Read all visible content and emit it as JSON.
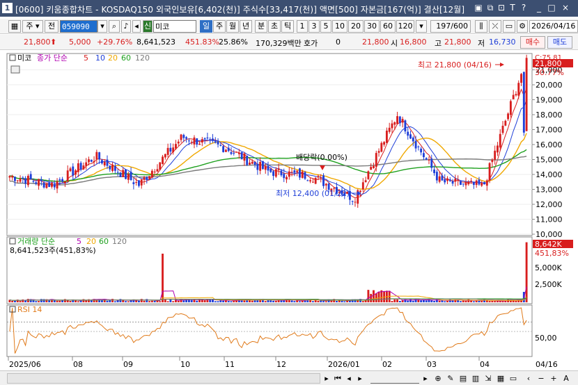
{
  "window": {
    "number": "1",
    "title": "[0600] 키움종합차트 - KOSDAQ150 외국인보유[6,402(천)] 주식수[33,417(천)] 액면[500] 자본금[167(억)] 결산[12월]"
  },
  "toolbar": {
    "code": "059090",
    "ju": "주",
    "jeon": "전",
    "badge_sin": "신",
    "stock_name": "미코",
    "periods": [
      "일",
      "주",
      "월",
      "년",
      "분",
      "초",
      "틱"
    ],
    "selected_period": "일",
    "intervals": [
      "1",
      "3",
      "5",
      "10",
      "20",
      "30",
      "60",
      "120"
    ],
    "count": "197/600",
    "date": "2026/04/16"
  },
  "quote": {
    "price": "21,800",
    "change": "5,000",
    "change_pct": "+29.76%",
    "volume": "8,641,523",
    "volume_pct": "451.83%",
    "turnover": "25.86%",
    "amount": "170,329백만",
    "hoga_label": "호가",
    "hoga_value": "0",
    "ask": "21,800",
    "open_label": "시",
    "open": "16,800",
    "high_label": "고",
    "high": "21,800",
    "low_label": "저",
    "low": "16,730",
    "sell": "매수",
    "buy": "매도"
  },
  "price_panel": {
    "name_label": "미코",
    "legend_prefix": "종가 단순",
    "ma": [
      {
        "period": "5",
        "color": "#d81e1e"
      },
      {
        "period": "10",
        "color": "#1f3fd8"
      },
      {
        "period": "20",
        "color": "#f0a800"
      },
      {
        "period": "60",
        "color": "#1ea01e"
      },
      {
        "period": "120",
        "color": "#7a7a7a"
      }
    ],
    "current_tag": "21,800",
    "current_pct": "30.77%",
    "top_tag": "C:75.81",
    "high_note": "최고 21,800 (04/16)",
    "low_note": "최저 12,400 (01/22)",
    "dividend_note": "배당락(0.00%)",
    "y_ticks": [
      "21,000",
      "20,000",
      "19,000",
      "18,000",
      "17,000",
      "16,000",
      "15,000",
      "14,000",
      "13,000",
      "12,000",
      "11,000",
      "10,000"
    ]
  },
  "volume_panel": {
    "legend_prefix": "거래량 단순",
    "ma": [
      {
        "period": "5",
        "color": "#b000b0"
      },
      {
        "period": "20",
        "color": "#f0a800"
      },
      {
        "period": "60",
        "color": "#1ea01e"
      },
      {
        "period": "120",
        "color": "#7a7a7a"
      }
    ],
    "value_label": "8,641,523주(451,83%)",
    "current_tag": "8,642K",
    "current_pct": "451,83%",
    "y_ticks": [
      "5,000K",
      "2,500K"
    ]
  },
  "rsi_panel": {
    "label": "RSI 14",
    "y_ticks": [
      "50,00"
    ]
  },
  "x_axis": [
    "2025/06",
    "08",
    "09",
    "10",
    "11",
    "12",
    "2026/01",
    "02",
    "03",
    "04",
    "04/16"
  ],
  "colors": {
    "up": "#d81e1e",
    "down": "#1f3fd8",
    "title_bg": "#3c4f71",
    "selected_tab": "#2e6fc5"
  },
  "chart_data": {
    "type": "candlestick",
    "period": "daily",
    "x_range": [
      "2025/06",
      "2026/04/16"
    ],
    "ylim": [
      10000,
      22000
    ],
    "ylabel_ticks": [
      10000,
      11000,
      12000,
      13000,
      14000,
      15000,
      16000,
      17000,
      18000,
      19000,
      20000,
      21000
    ],
    "close_trend": [
      {
        "date": "2025/06",
        "close": 13900
      },
      {
        "date": "2025/07",
        "close": 13300
      },
      {
        "date": "2025/08",
        "close": 15200
      },
      {
        "date": "2025/08-late",
        "close": 13300
      },
      {
        "date": "2025/09",
        "close": 16500
      },
      {
        "date": "2025/10",
        "close": 15800
      },
      {
        "date": "2025/11",
        "close": 14200
      },
      {
        "date": "2025/12",
        "close": 13900
      },
      {
        "date": "2026/01/22",
        "close": 12400
      },
      {
        "date": "2026/02",
        "close": 18000
      },
      {
        "date": "2026/03",
        "close": 13500
      },
      {
        "date": "2026/04",
        "close": 13200
      },
      {
        "date": "2026/04/16",
        "close": 21800
      }
    ],
    "series": [
      {
        "name": "종가",
        "values": [
          13900,
          13300,
          15200,
          13300,
          16500,
          15800,
          14200,
          13900,
          12400,
          18000,
          13500,
          13200,
          21800
        ]
      }
    ],
    "annotations": [
      {
        "text": "최고 21,800 (04/16)",
        "value": 21800
      },
      {
        "text": "최저 12,400 (01/22)",
        "value": 12400
      },
      {
        "text": "배당락(0.00%)"
      }
    ],
    "volume_ylim": [
      0,
      9000000
    ],
    "volume_last": 8641523,
    "rsi_period": 14
  }
}
